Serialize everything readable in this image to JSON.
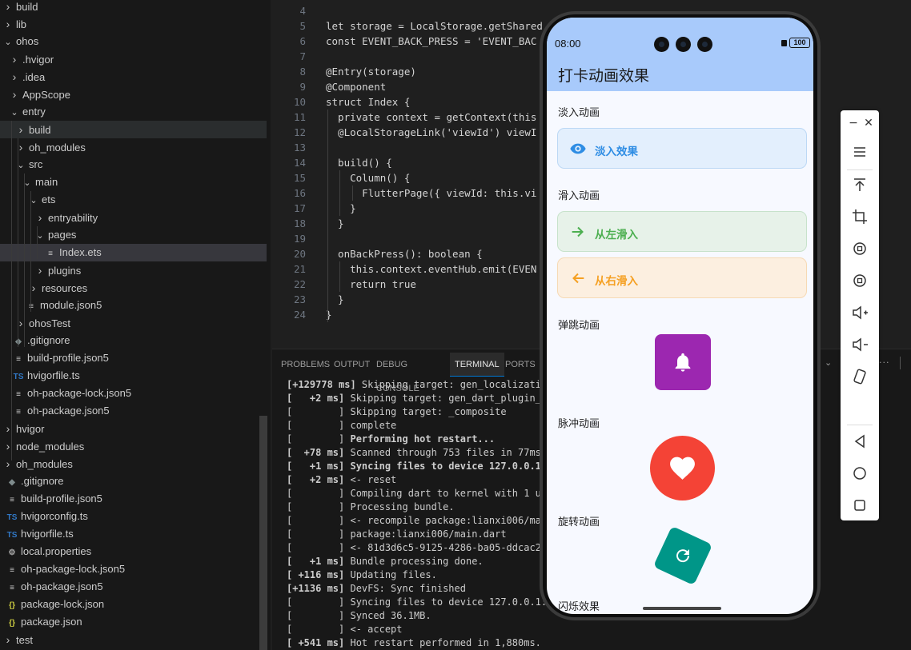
{
  "explorer": {
    "items": [
      {
        "label": "build",
        "chevron": "right",
        "icon": ""
      },
      {
        "label": "lib",
        "chevron": "right",
        "icon": ""
      },
      {
        "label": "ohos",
        "chevron": "down",
        "icon": ""
      },
      {
        "label": ".hvigor",
        "chevron": "right",
        "icon": ""
      },
      {
        "label": ".idea",
        "chevron": "right",
        "icon": ""
      },
      {
        "label": "AppScope",
        "chevron": "right",
        "icon": ""
      },
      {
        "label": "entry",
        "chevron": "down",
        "icon": ""
      },
      {
        "label": "build",
        "chevron": "right",
        "icon": ""
      },
      {
        "label": "oh_modules",
        "chevron": "right",
        "icon": ""
      },
      {
        "label": "src",
        "chevron": "down",
        "icon": ""
      },
      {
        "label": "main",
        "chevron": "down",
        "icon": ""
      },
      {
        "label": "ets",
        "chevron": "down",
        "icon": ""
      },
      {
        "label": "entryability",
        "chevron": "right",
        "icon": ""
      },
      {
        "label": "pages",
        "chevron": "down",
        "icon": ""
      },
      {
        "label": "Index.ets",
        "chevron": "",
        "icon": "lines"
      },
      {
        "label": "plugins",
        "chevron": "right",
        "icon": ""
      },
      {
        "label": "resources",
        "chevron": "right",
        "icon": ""
      },
      {
        "label": "module.json5",
        "chevron": "",
        "icon": "lines"
      },
      {
        "label": "ohosTest",
        "chevron": "right",
        "icon": ""
      },
      {
        "label": ".gitignore",
        "chevron": "",
        "icon": "git"
      },
      {
        "label": "build-profile.json5",
        "chevron": "",
        "icon": "lines"
      },
      {
        "label": "hvigorfile.ts",
        "chevron": "",
        "icon": "ts"
      },
      {
        "label": "oh-package-lock.json5",
        "chevron": "",
        "icon": "lines"
      },
      {
        "label": "oh-package.json5",
        "chevron": "",
        "icon": "lines"
      },
      {
        "label": "hvigor",
        "chevron": "right",
        "icon": ""
      },
      {
        "label": "node_modules",
        "chevron": "right",
        "icon": ""
      },
      {
        "label": "oh_modules",
        "chevron": "right",
        "icon": ""
      },
      {
        "label": ".gitignore",
        "chevron": "",
        "icon": "git"
      },
      {
        "label": "build-profile.json5",
        "chevron": "",
        "icon": "lines"
      },
      {
        "label": "hvigorconfig.ts",
        "chevron": "",
        "icon": "ts"
      },
      {
        "label": "hvigorfile.ts",
        "chevron": "",
        "icon": "ts"
      },
      {
        "label": "local.properties",
        "chevron": "",
        "icon": "gear"
      },
      {
        "label": "oh-package-lock.json5",
        "chevron": "",
        "icon": "lines"
      },
      {
        "label": "oh-package.json5",
        "chevron": "",
        "icon": "lines"
      },
      {
        "label": "package-lock.json",
        "chevron": "",
        "icon": "json"
      },
      {
        "label": "package.json",
        "chevron": "",
        "icon": "json"
      },
      {
        "label": "test",
        "chevron": "right",
        "icon": ""
      }
    ]
  },
  "editor": {
    "lines": [
      {
        "n": "4",
        "code": ""
      },
      {
        "n": "5",
        "code": "let storage = LocalStorage.getShared"
      },
      {
        "n": "6",
        "code": "const EVENT_BACK_PRESS = 'EVENT_BAC"
      },
      {
        "n": "7",
        "code": ""
      },
      {
        "n": "8",
        "code": "@Entry(storage)"
      },
      {
        "n": "9",
        "code": "@Component"
      },
      {
        "n": "10",
        "code": "struct Index {"
      },
      {
        "n": "11",
        "code": "  private context = getContext(this"
      },
      {
        "n": "12",
        "code": "  @LocalStorageLink('viewId') viewI"
      },
      {
        "n": "13",
        "code": ""
      },
      {
        "n": "14",
        "code": "  build() {"
      },
      {
        "n": "15",
        "code": "    Column() {"
      },
      {
        "n": "16",
        "code": "      FlutterPage({ viewId: this.vi"
      },
      {
        "n": "17",
        "code": "    }"
      },
      {
        "n": "18",
        "code": "  }"
      },
      {
        "n": "19",
        "code": ""
      },
      {
        "n": "20",
        "code": "  onBackPress(): boolean {"
      },
      {
        "n": "21",
        "code": "    this.context.eventHub.emit(EVEN"
      },
      {
        "n": "22",
        "code": "    return true"
      },
      {
        "n": "23",
        "code": "  }"
      },
      {
        "n": "24",
        "code": "}"
      }
    ]
  },
  "panel": {
    "tabs": [
      "PROBLEMS",
      "OUTPUT",
      "DEBUG CONSOLE",
      "TERMINAL",
      "PORTS"
    ],
    "active_tab": "TERMINAL",
    "terminal": [
      {
        "prefix": "[+129778 ms]",
        "bold_prefix": true,
        "text": " Skipping target: gen_localizatio",
        "bold": false
      },
      {
        "prefix": "[   +2 ms]",
        "bold_prefix": true,
        "text": " Skipping target: gen_dart_plugin_r",
        "bold": false
      },
      {
        "prefix": "[        ]",
        "bold_prefix": false,
        "text": " Skipping target: _composite",
        "bold": false
      },
      {
        "prefix": "[        ]",
        "bold_prefix": false,
        "text": " complete",
        "bold": false
      },
      {
        "prefix": "[        ]",
        "bold_prefix": false,
        "text": " Performing hot restart...",
        "bold": true
      },
      {
        "prefix": "[  +78 ms]",
        "bold_prefix": true,
        "text": " Scanned through 753 files in 77ms",
        "bold": false
      },
      {
        "prefix": "[   +1 ms]",
        "bold_prefix": true,
        "text": " Syncing files to device 127.0.0.1:",
        "bold": true
      },
      {
        "prefix": "[   +2 ms]",
        "bold_prefix": true,
        "text": " <- reset",
        "bold": false
      },
      {
        "prefix": "[        ]",
        "bold_prefix": false,
        "text": " Compiling dart to kernel with 1 up",
        "bold": false
      },
      {
        "prefix": "[        ]",
        "bold_prefix": false,
        "text": " Processing bundle.",
        "bold": false
      },
      {
        "prefix": "[        ]",
        "bold_prefix": false,
        "text": " <- recompile package:lianxi006/mai",
        "bold": false
      },
      {
        "prefix": "[        ]",
        "bold_prefix": false,
        "text": " package:lianxi006/main.dart",
        "bold": false
      },
      {
        "prefix": "[        ]",
        "bold_prefix": false,
        "text": " <- 81d3d6c5-9125-4286-ba05-ddcac25",
        "bold": false
      },
      {
        "prefix": "[   +1 ms]",
        "bold_prefix": true,
        "text": " Bundle processing done.",
        "bold": false
      },
      {
        "prefix": "[ +116 ms]",
        "bold_prefix": true,
        "text": " Updating files.",
        "bold": false
      },
      {
        "prefix": "[+1136 ms]",
        "bold_prefix": true,
        "text": " DevFS: Sync finished",
        "bold": false
      },
      {
        "prefix": "[        ]",
        "bold_prefix": false,
        "text": " Syncing files to device 127.0.0.1:",
        "bold": false
      },
      {
        "prefix": "[        ]",
        "bold_prefix": false,
        "text": " Synced 36.1MB.",
        "bold": false
      },
      {
        "prefix": "[        ]",
        "bold_prefix": false,
        "text": " <- accept",
        "bold": false
      },
      {
        "prefix": "[ +541 ms]",
        "bold_prefix": true,
        "text": " Hot restart performed in 1,880ms.",
        "bold": false
      }
    ]
  },
  "phone": {
    "time": "08:00",
    "battery": "100",
    "app_title": "打卡动画效果",
    "sections": {
      "fade": {
        "title": "淡入动画",
        "button": "淡入效果"
      },
      "slide": {
        "title": "滑入动画",
        "left": "从左滑入",
        "right": "从右滑入"
      },
      "bounce": {
        "title": "弹跳动画"
      },
      "pulse": {
        "title": "脉冲动画"
      },
      "rotate": {
        "title": "旋转动画"
      },
      "blink": {
        "title": "闪烁效果"
      }
    },
    "colors": {
      "appbar": "#a8cafb",
      "fade_bg": "#e3effd",
      "fade_fg": "#2f8de4",
      "left_bg": "#e7f2e9",
      "left_fg": "#4caf50",
      "right_bg": "#fcefe0",
      "right_fg": "#f5a022",
      "bell_bg": "#9c27b0",
      "heart_bg": "#f44336",
      "rotate_bg": "#009688"
    }
  },
  "toolbar": {
    "icons": [
      "minimize-icon",
      "close-icon",
      "menu-icon",
      "pin-top-icon",
      "crop-icon",
      "rotate-left-icon",
      "rotate-right-icon",
      "volume-up-icon",
      "volume-down-icon",
      "shake-icon",
      "back-icon",
      "home-icon",
      "recents-icon"
    ]
  }
}
